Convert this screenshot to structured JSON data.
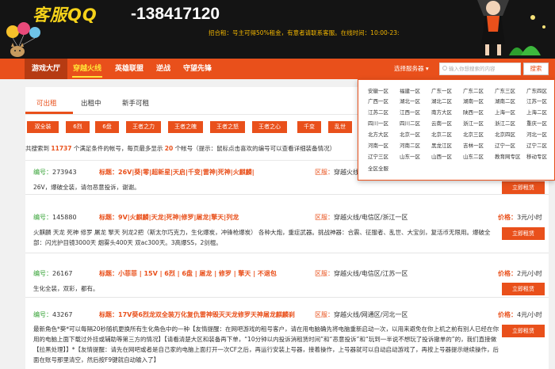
{
  "header": {
    "qq_label": "客服QQ",
    "phone": "-138417120",
    "tagline": "招合租：号主可得50%租金，有意者请联系客服。在线时间：10:00-23:"
  },
  "nav": {
    "items": [
      "游戏大厅",
      "穿越火线",
      "英雄联盟",
      "逆战",
      "守望先锋"
    ],
    "region_select": "选择服务器 ▾",
    "search_placeholder": "输入你想搜索的内容",
    "search_button": "搜索"
  },
  "tabs": [
    "可出租",
    "出租中",
    "新手可租"
  ],
  "filters": [
    "双全装",
    "6烈",
    "6盘",
    "王者之力",
    "王者之魄",
    "王者之怒",
    "王者之心",
    "千变",
    "乱世"
  ],
  "summary": {
    "prefix": "共搜索到",
    "count": "11737",
    "middle": "个满足条件的帐号，每页最多显示",
    "per_page": "20",
    "suffix": "个帐号（提示：鼠标点击喜欢的编号可以查看详细装备情况）"
  },
  "labels": {
    "no": "编号：",
    "title": "标题：",
    "region": "区服：",
    "price": "价格：",
    "rent": "立即租赁"
  },
  "listings": [
    {
      "no": "273943",
      "title": "26V|葵|零|超新星|天启|千变|雷神|死神|火麒麟|",
      "region": "穿越火线/",
      "price": "",
      "desc": "26V，爆破全装，请勿恶意投诉，谢谢。"
    },
    {
      "no": "145880",
      "title": "9V|火麒麟|天龙|死神|修罗|屠龙|擎天|列龙",
      "region": "穿越火线/电信区/浙江一区",
      "price": "3元/小时",
      "desc": "火麒麟 天龙 死神 修罗 屠龙 擎天 列龙2把（斯太尔巧克力，生化爆炭，冲锋枪爆炭） 各种大炮，重症武器。挑战神器：合震、征服者、乱世、大宝剑，复活币无限用。爆破全部：闪光护目镜3000天 烟雾头400天 双ac300天。3高爆SS，2剑棍。"
    },
    {
      "no": "26167",
      "title": "小菲菲 | 15V | 6烈 | 6盘 | 屠龙 | 修罗 | 擎天 | 不退包",
      "region": "穿越火线/电信区/江苏一区",
      "price": "2元/小时",
      "desc": "生化全装，双彩，都有。"
    },
    {
      "no": "43267",
      "title": "17V葵6烈龙双全装万化复仇雷神毁灭天龙修罗天神屠龙麒麟刹",
      "region": "穿越火线/网通区/河北一区",
      "price": "4元/小时",
      "desc": "最新角色*葵*可以每隔20秒随机更换所有生化角色中的一种【友情提醒：在网吧游戏的租号客户，请在用电脑确先将电脑重新启动一次，以用来避免在你上机之前有别人已经在你用的电脑上面下载过外挂或辅助等第三方的情况】【请看清楚大区和装备再下单，“10分钟以内投诉消租赁时间”和“恶意投诉”和“玩到一半说不想玩了投诉撤单的”的，我们直接做【拉黑处理】】*【友情提醒：请先在网吧或者是自己家的电脑上面打开一次CF之后，再运行安装上号器，接着操作，上号器就可以自动启动游戏了，再按上号器提示继续操作，后面在账号那里清空，然后按F9键就自动输入了】"
    }
  ],
  "dropdown": [
    [
      "安徽一区",
      "福建一区",
      "广东一区",
      "广东二区",
      "广东三区",
      "广东四区"
    ],
    [
      "广西一区",
      "湖北一区",
      "湖北二区",
      "湖南一区",
      "湖南二区",
      "江苏一区"
    ],
    [
      "江苏二区",
      "江西一区",
      "南方大区",
      "陕西一区",
      "上海一区",
      "上海二区"
    ],
    [
      "四川一区",
      "四川二区",
      "云南一区",
      "浙江一区",
      "浙江二区",
      "重庆一区"
    ],
    [
      "北方大区",
      "北京一区",
      "北京二区",
      "北京三区",
      "北京四区",
      "河北一区"
    ],
    [
      "河南一区",
      "河南二区",
      "黑龙江区",
      "吉林一区",
      "辽宁一区",
      "辽宁二区"
    ],
    [
      "辽宁三区",
      "山东一区",
      "山西一区",
      "山东二区",
      "教育网专区",
      "移动专区"
    ],
    [
      "全区全服"
    ]
  ],
  "colors": {
    "brand": "#e9501b",
    "header_bg": "#141414",
    "accent_yellow": "#ffe338",
    "green_label": "#2e9f2e"
  }
}
